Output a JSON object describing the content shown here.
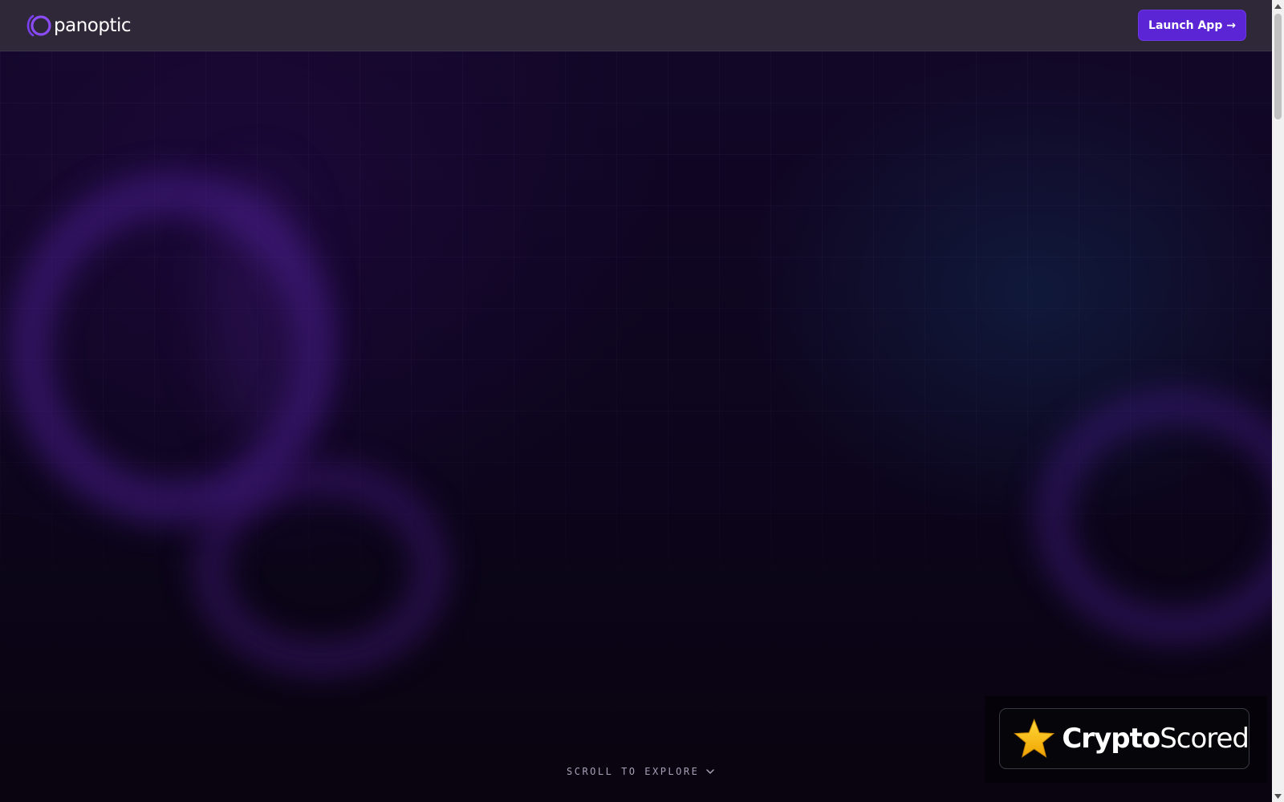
{
  "header": {
    "logo_text": "panoptic",
    "launch_label": "Launch App →"
  },
  "hero": {
    "scroll_hint": "SCROLL TO EXPLORE"
  },
  "badge": {
    "brand_bold": "Crypto",
    "brand_light": "Scored"
  },
  "colors": {
    "accent": "#5b25d6",
    "header_bg": "#2f2838",
    "hero_bg": "#0c051b",
    "logo_mark": "#7b3ff2",
    "star": "#f5b800"
  },
  "icons": {
    "logo": "panoptic-logo-icon",
    "chevron": "chevron-down-icon",
    "star": "star-icon"
  },
  "scrollbar": {
    "position_fraction": 0.0
  }
}
